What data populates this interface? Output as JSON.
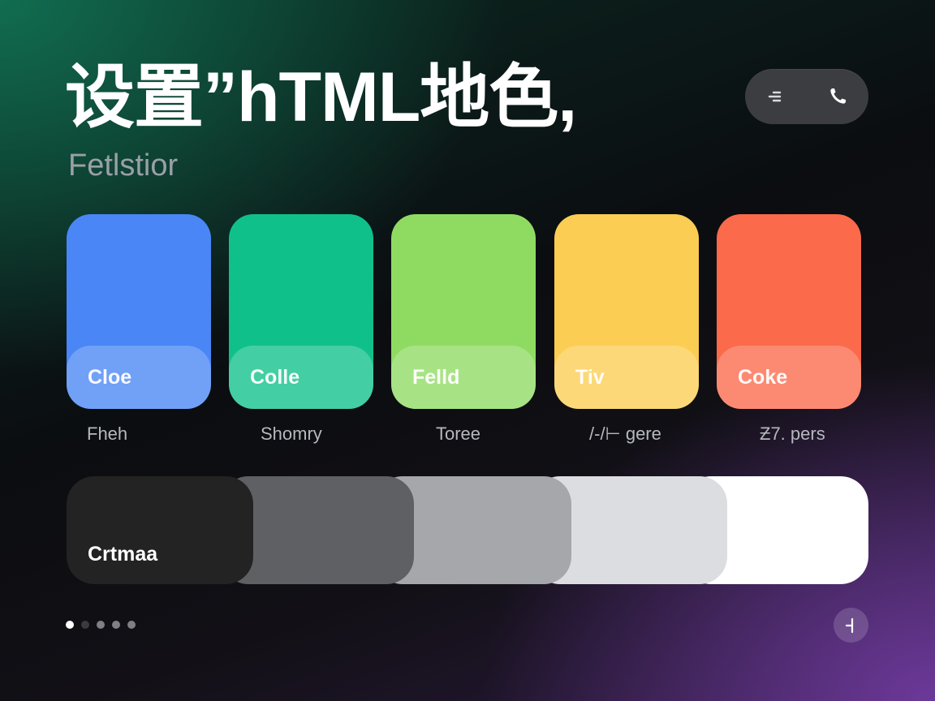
{
  "header": {
    "title": "设置”hTML地色,",
    "subtitle": "Fetlstior"
  },
  "pill_controls": {
    "left_icon": "list-indent-icon",
    "right_icon": "phone-icon"
  },
  "swatches": [
    {
      "label": "Cloe",
      "caption": "Fheh",
      "color": "#4a86f5"
    },
    {
      "label": "Colle",
      "caption": "Shomry",
      "color": "#10c08a"
    },
    {
      "label": "Felld",
      "caption": "Toree",
      "color": "#8fdb62"
    },
    {
      "label": "Tiv",
      "caption": "/-/⊢ gere",
      "color": "#fbcd52"
    },
    {
      "label": "Coke",
      "caption": "Ƶ7. pers",
      "color": "#fb6a4b"
    }
  ],
  "grayscale": {
    "label": "Crtmaa",
    "colors": [
      "#232323",
      "#5f6063",
      "#a6a7aa",
      "#dcdde0",
      "#ffffff"
    ]
  },
  "pagination": {
    "total": 5,
    "active": 1
  },
  "corner_button": {
    "icon": "split-icon"
  }
}
